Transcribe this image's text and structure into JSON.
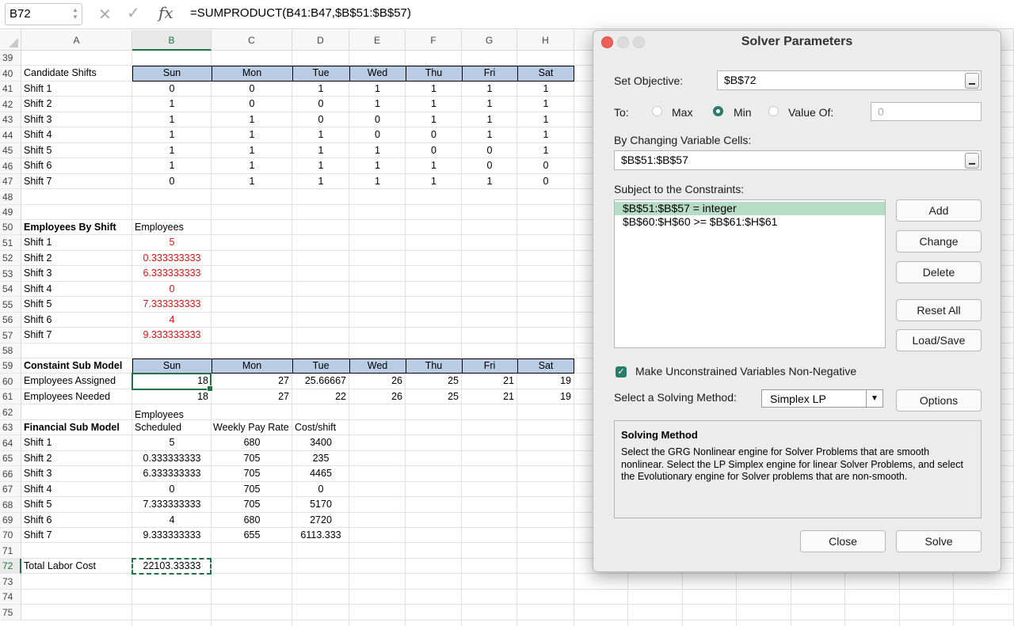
{
  "formula_bar": {
    "cell_ref": "B72",
    "cancel": "✕",
    "enter": "✓",
    "fx": "fx",
    "formula": "=SUMPRODUCT(B41:B47,$B$51:$B$57)"
  },
  "columns": [
    "A",
    "B",
    "C",
    "D",
    "E",
    "F",
    "G",
    "H"
  ],
  "rows": [
    "39",
    "40",
    "41",
    "42",
    "43",
    "44",
    "45",
    "46",
    "47",
    "48",
    "49",
    "50",
    "51",
    "52",
    "53",
    "54",
    "55",
    "56",
    "57",
    "58",
    "59",
    "60",
    "61",
    "62",
    "63",
    "64",
    "65",
    "66",
    "67",
    "68",
    "69",
    "70",
    "71",
    "72",
    "73",
    "74",
    "75"
  ],
  "candidate_shifts": {
    "title": "Candidate Shifts",
    "days": [
      "Sun",
      "Mon",
      "Tue",
      "Wed",
      "Thu",
      "Fri",
      "Sat"
    ],
    "shifts": [
      {
        "name": "Shift 1",
        "vals": [
          "0",
          "0",
          "1",
          "1",
          "1",
          "1",
          "1"
        ]
      },
      {
        "name": "Shift 2",
        "vals": [
          "1",
          "0",
          "0",
          "1",
          "1",
          "1",
          "1"
        ]
      },
      {
        "name": "Shift 3",
        "vals": [
          "1",
          "1",
          "0",
          "0",
          "1",
          "1",
          "1"
        ]
      },
      {
        "name": "Shift 4",
        "vals": [
          "1",
          "1",
          "1",
          "0",
          "0",
          "1",
          "1"
        ]
      },
      {
        "name": "Shift 5",
        "vals": [
          "1",
          "1",
          "1",
          "1",
          "0",
          "0",
          "1"
        ]
      },
      {
        "name": "Shift 6",
        "vals": [
          "1",
          "1",
          "1",
          "1",
          "1",
          "0",
          "0"
        ]
      },
      {
        "name": "Shift 7",
        "vals": [
          "0",
          "1",
          "1",
          "1",
          "1",
          "1",
          "0"
        ]
      }
    ]
  },
  "employees_by_shift": {
    "title": "Employees By Shift",
    "header": "Employees",
    "rows": [
      {
        "name": "Shift 1",
        "val": "5"
      },
      {
        "name": "Shift 2",
        "val": "0.333333333"
      },
      {
        "name": "Shift 3",
        "val": "6.333333333"
      },
      {
        "name": "Shift 4",
        "val": "0"
      },
      {
        "name": "Shift 5",
        "val": "7.333333333"
      },
      {
        "name": "Shift 6",
        "val": "4"
      },
      {
        "name": "Shift 7",
        "val": "9.333333333"
      }
    ]
  },
  "constraint": {
    "title": "Constaint Sub Model",
    "days": [
      "Sun",
      "Mon",
      "Tue",
      "Wed",
      "Thu",
      "Fri",
      "Sat"
    ],
    "assigned_label": "Employees Assigned",
    "assigned": [
      "18",
      "27",
      "25.66667",
      "26",
      "25",
      "21",
      "19"
    ],
    "needed_label": "Employees Needed",
    "needed": [
      "18",
      "27",
      "22",
      "26",
      "25",
      "21",
      "19"
    ]
  },
  "financial": {
    "title": "Financial Sub Model",
    "h1a": "Employees",
    "h1b": "Scheduled",
    "h2": "Weekly Pay Rate",
    "h3": "Cost/shift",
    "rows": [
      {
        "name": "Shift 1",
        "sched": "5",
        "rate": "680",
        "cost": "3400"
      },
      {
        "name": "Shift 2",
        "sched": "0.333333333",
        "rate": "705",
        "cost": "235"
      },
      {
        "name": "Shift 3",
        "sched": "6.333333333",
        "rate": "705",
        "cost": "4465"
      },
      {
        "name": "Shift 4",
        "sched": "0",
        "rate": "705",
        "cost": "0"
      },
      {
        "name": "Shift 5",
        "sched": "7.333333333",
        "rate": "705",
        "cost": "5170"
      },
      {
        "name": "Shift 6",
        "sched": "4",
        "rate": "680",
        "cost": "2720"
      },
      {
        "name": "Shift 7",
        "sched": "9.333333333",
        "rate": "655",
        "cost": "6113.333"
      }
    ],
    "total_label": "Total Labor Cost",
    "total": "22103.33333"
  },
  "solver": {
    "title": "Solver Parameters",
    "set_objective_label": "Set Objective:",
    "objective": "$B$72",
    "to_label": "To:",
    "max": "Max",
    "min": "Min",
    "value_of": "Value Of:",
    "value_of_val": "0",
    "changing_label": "By Changing Variable Cells:",
    "changing": "$B$51:$B$57",
    "constraints_label": "Subject to the Constraints:",
    "constraints": [
      "$B$51:$B$57 = integer",
      "$B$60:$H$60 >= $B$61:$H$61"
    ],
    "buttons": {
      "add": "Add",
      "change": "Change",
      "delete": "Delete",
      "reset": "Reset All",
      "load": "Load/Save",
      "options": "Options",
      "close": "Close",
      "solve": "Solve"
    },
    "nonneg_label": "Make Unconstrained Variables Non-Negative",
    "nonneg_checked": true,
    "method_label": "Select a Solving Method:",
    "method": "Simplex LP",
    "desc_title": "Solving Method",
    "desc_body": "Select the GRG Nonlinear engine for Solver Problems that are smooth nonlinear. Select the LP Simplex engine for linear Solver Problems, and select the Evolutionary engine for Solver problems that are non-smooth."
  },
  "colors": {
    "accent": "#217346",
    "header_band": "#b9cce4",
    "red_text": "#e01010",
    "radio_on": "#2a7d6b"
  }
}
